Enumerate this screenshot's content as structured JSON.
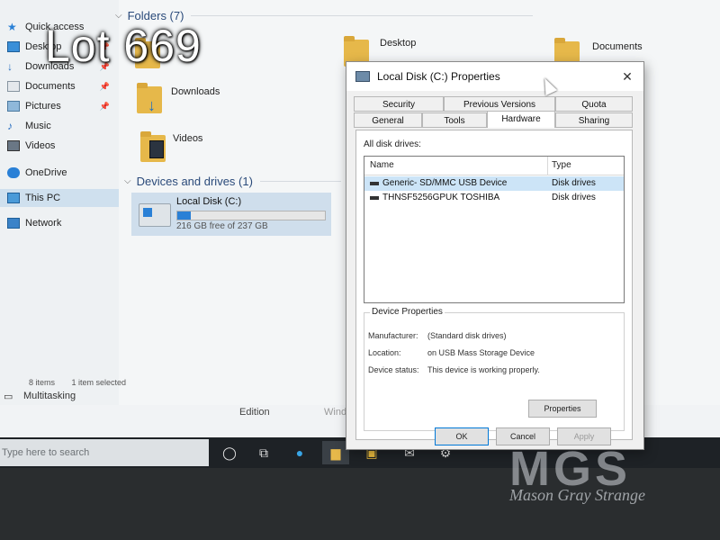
{
  "overlay": {
    "lot_label": "Lot 669",
    "watermark_logo": "MGS",
    "watermark_name": "Mason Gray Strange"
  },
  "sidebar": {
    "items": [
      {
        "label": "Quick access",
        "icon": "star-icon"
      },
      {
        "label": "Desktop",
        "icon": "desktop-icon",
        "pinned": true
      },
      {
        "label": "Downloads",
        "icon": "download-icon",
        "pinned": true
      },
      {
        "label": "Documents",
        "icon": "documents-icon",
        "pinned": true
      },
      {
        "label": "Pictures",
        "icon": "pictures-icon",
        "pinned": true
      },
      {
        "label": "Music",
        "icon": "music-icon"
      },
      {
        "label": "Videos",
        "icon": "videos-icon"
      },
      {
        "label": "OneDrive",
        "icon": "cloud-icon"
      },
      {
        "label": "This PC",
        "icon": "pc-icon",
        "selected": true
      },
      {
        "label": "Network",
        "icon": "network-icon"
      }
    ]
  },
  "main": {
    "folders_header": "Folders (7)",
    "folders": [
      "Desktop",
      "Documents",
      "Downloads",
      "Videos"
    ],
    "devices_header": "Devices and drives (1)",
    "drive": {
      "name": "Local Disk (C:)",
      "free": "216 GB free of 237 GB",
      "used_fraction": 0.09
    },
    "status": {
      "items": "8 items",
      "selected": "1 item selected"
    }
  },
  "settings": {
    "multitasking": "Multitasking",
    "edition": "Edition",
    "wind": "Wind"
  },
  "taskbar": {
    "search_placeholder": "Type here to search"
  },
  "dialog": {
    "title": "Local Disk (C:) Properties",
    "tabs_row1": [
      "Security",
      "Previous Versions",
      "Quota"
    ],
    "tabs_row2": [
      "General",
      "Tools",
      "Hardware",
      "Sharing"
    ],
    "active_tab": "Hardware",
    "all_disk_drives_label": "All disk drives:",
    "columns": [
      "Name",
      "Type"
    ],
    "drives": [
      {
        "name": "Generic- SD/MMC USB Device",
        "type": "Disk drives",
        "selected": true
      },
      {
        "name": "THNSF5256GPUK TOSHIBA",
        "type": "Disk drives",
        "selected": false
      }
    ],
    "device_properties": {
      "legend": "Device Properties",
      "manufacturer_label": "Manufacturer:",
      "manufacturer": "(Standard disk drives)",
      "location_label": "Location:",
      "location": "on USB Mass Storage Device",
      "status_label": "Device status:",
      "status": "This device is working properly.",
      "properties_button": "Properties"
    },
    "buttons": {
      "ok": "OK",
      "cancel": "Cancel",
      "apply": "Apply"
    }
  }
}
